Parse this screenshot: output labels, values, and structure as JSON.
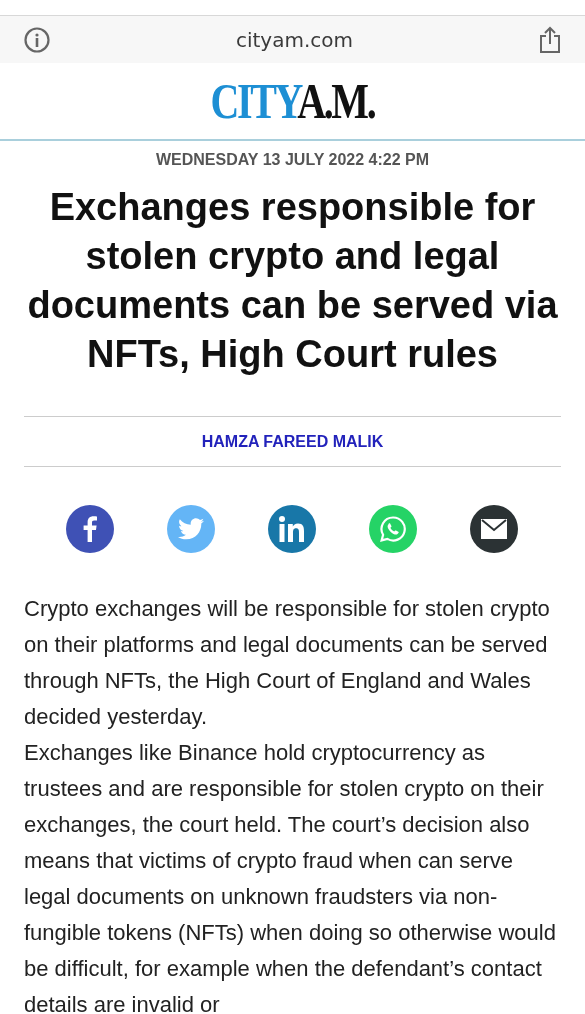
{
  "browser": {
    "address": "cityam.com"
  },
  "logo": {
    "first": "CITY",
    "second": "A.M."
  },
  "article": {
    "date": "WEDNESDAY 13 JULY 2022 4:22 PM",
    "headline": "Exchanges responsible for stolen crypto and legal documents can be served via NFTs, High Court rules",
    "author": "HAMZA FAREED MALIK",
    "share": [
      {
        "kind": "facebook",
        "color": "#3f51b5"
      },
      {
        "kind": "twitter",
        "color": "#64b5f6"
      },
      {
        "kind": "linkedin",
        "color": "#1877a8"
      },
      {
        "kind": "whatsapp",
        "color": "#25d366"
      },
      {
        "kind": "email",
        "color": "#2b3234"
      }
    ],
    "body": [
      "Crypto exchanges will be responsible for stolen crypto on their platforms and legal documents can be served through NFTs, the High Court of England and Wales decided yesterday.",
      "Exchanges like Binance hold cryptocurrency as trustees and are responsible for stolen crypto on their exchanges, the court held. The court’s decision also means that victims of crypto fraud when can serve legal documents on unknown fraudsters via non-fungible tokens (NFTs) when doing so otherwise would be difficult, for example when the defendant’s contact details are invalid or"
    ]
  }
}
